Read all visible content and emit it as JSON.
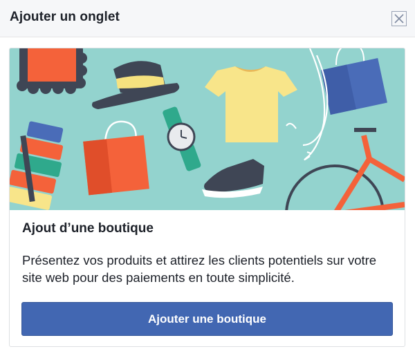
{
  "dialog": {
    "title": "Ajouter un onglet",
    "close_icon": "close-icon"
  },
  "card": {
    "banner_illustration": "shopping-illustration",
    "title": "Ajout d’une boutique",
    "description": "Présentez vos produits et attirez les clients potentiels sur votre site web pour des paiements en toute simplicité.",
    "button_label": "Ajouter une boutique"
  },
  "colors": {
    "accent": "#4267b2",
    "banner_bg": "#93d3ce",
    "header_bg": "#f6f7f9"
  }
}
